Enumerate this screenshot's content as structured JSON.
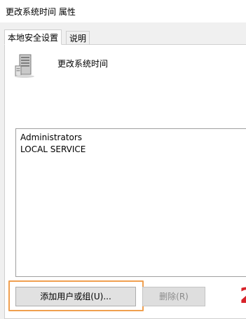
{
  "window": {
    "title": "更改系统时间 属性"
  },
  "tabs": [
    {
      "label": "本地安全设置",
      "active": true
    },
    {
      "label": "说明",
      "active": false
    }
  ],
  "policy": {
    "name": "更改系统时间",
    "icon": "server-icon"
  },
  "members": [
    "Administrators",
    "LOCAL SERVICE"
  ],
  "buttons": {
    "add_label": "添加用户或组(U)...",
    "remove_label": "删除(R)"
  },
  "colors": {
    "highlight": "#f0a050",
    "watermark": "#d8232a"
  }
}
